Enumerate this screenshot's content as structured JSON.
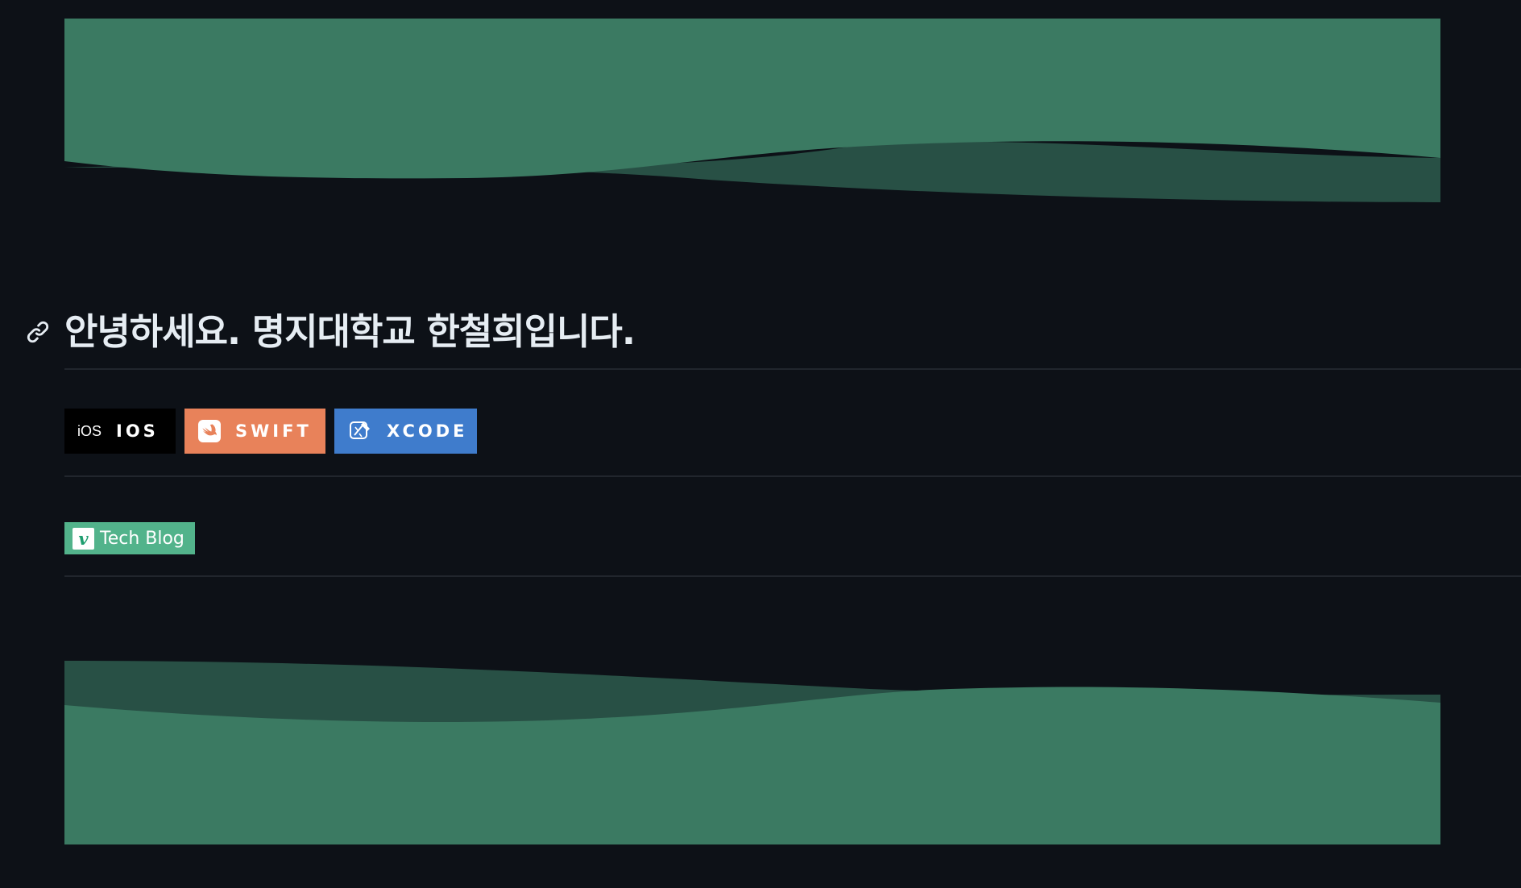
{
  "header_wave": {
    "colors": {
      "front": "#3b7a62",
      "back": "#285045"
    }
  },
  "heading": {
    "text": "안녕하세요. 명지대학교 한철희입니다.",
    "anchor_icon": "link-icon"
  },
  "badges": [
    {
      "logo": "iOS",
      "label": "IOS",
      "icon": "ios-icon",
      "color": "#000000"
    },
    {
      "label": "SWIFT",
      "icon": "swift-icon",
      "color": "#e8825a"
    },
    {
      "label": "XCODE",
      "icon": "xcode-icon",
      "color": "#3f7ccc"
    }
  ],
  "blog_badge": {
    "logo": "v",
    "label": "Tech Blog",
    "icon": "velog-icon",
    "color": "#52b38b"
  },
  "footer_wave": {
    "colors": {
      "front": "#3b7a62",
      "back": "#285045"
    }
  }
}
